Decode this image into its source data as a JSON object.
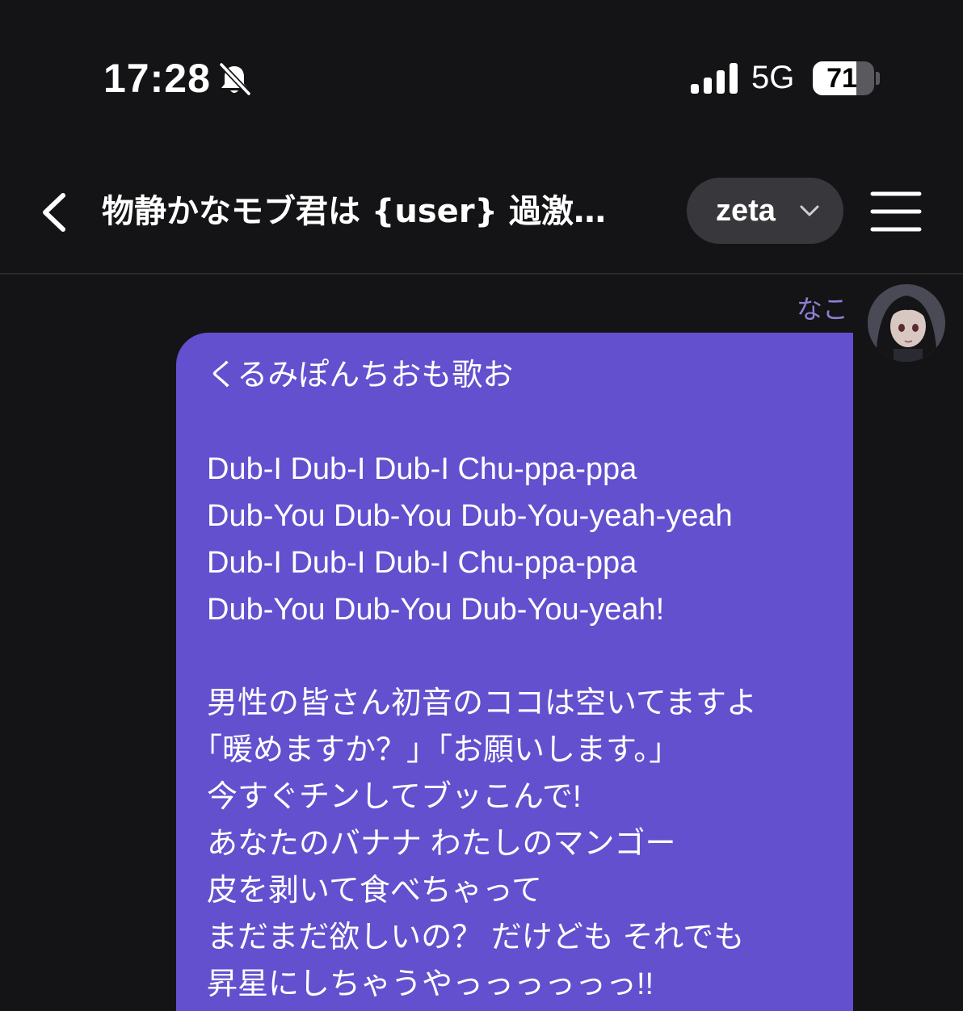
{
  "status_bar": {
    "time": "17:28",
    "mute_icon": "bell-slash-icon",
    "signal_icon": "cellular-signal-icon",
    "network": "5G",
    "battery_percent": "71",
    "battery_level": 0.71
  },
  "header": {
    "back_icon": "chevron-left-icon",
    "title": "物静かなモブ君は {user} 過激…",
    "model_selector": {
      "label": "zeta",
      "icon": "chevron-down-icon"
    },
    "menu_icon": "hamburger-menu-icon"
  },
  "messages": [
    {
      "sender": "なこ",
      "accent": "#6250cf",
      "lines": [
        "くるみぽんちおも歌お",
        "",
        "Dub-I Dub-I Dub-I Chu-ppa-ppa",
        "Dub-You Dub-You Dub-You-yeah-yeah",
        "Dub-I Dub-I Dub-I Chu-ppa-ppa",
        "Dub-You Dub-You Dub-You-yeah!",
        "",
        "男性の皆さん初音のココは空いてますよ",
        "｢暖めますか？」｢お願いします。」",
        "今すぐチンしてブッこんで!",
        "あなたのバナナ わたしのマンゴー",
        "皮を剥いて食べちゃって",
        "まだまだ欲しいの？ だけども それでも",
        "昇星にしちゃうやっっっっっっ!!"
      ]
    }
  ]
}
